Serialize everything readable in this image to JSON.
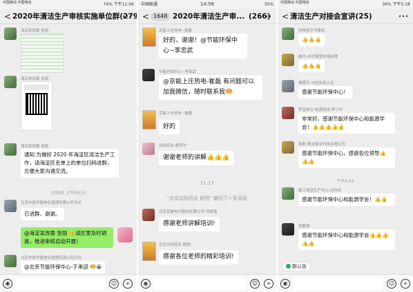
{
  "colors": {
    "bubble_self": "#95ec69",
    "bubble_other": "#ffffff",
    "chat_bg": "#ededed",
    "accent_green": "#2aae67"
  },
  "phone1": {
    "status": {
      "carrier": "中国移动 中国电信",
      "right": "74% 下午11:06"
    },
    "title": "2020年清洁生产审核实施单位群(279)",
    "back_icon": "<",
    "more_icon": "···",
    "messages": [
      {
        "sender": "海淀发改委 张丽"
      },
      {
        "sender": "海淀发改委 张丽"
      },
      {
        "sender": "海淀发改委 张丽",
        "text": "通知:为做好 2020 年海淀区清洁生产工作，请海淀区名单上的单位扫码进群，方便大家沟通交流。"
      },
      {
        "time": "5月8日 上午09:53"
      },
      {
        "sender": "北京中原华宸物业管理有限公司冯光",
        "text": "已进群、谢谢。"
      },
      {
        "text": "@海淀发改委 张丽 👍请区里及时调度，推进审核启动开展！"
      },
      {
        "sender": "北京中原华宸物业管理有限公司冯光",
        "text": "@北京节能环保中心-于承迎 🥯😀"
      }
    ]
  },
  "phone2": {
    "status": {
      "carrier": "中国联通",
      "time": "14:56",
      "right": "35%"
    },
    "badge": "1648",
    "title": "2020年清洁生产审...",
    "count": "(266)",
    "more_icon": "···",
    "messages": [
      {
        "sender": "京能上庄热电--崔磊",
        "text": "好的，谢谢！@节能环保中心~李忠武"
      },
      {
        "sender": "节能环保中心~李忠武",
        "text": "@京能上庄热电-崔磊 有问题可以加我微信，随时联系我🥯"
      },
      {
        "sender": "京能上庄热电--崔磊",
        "text": "好的"
      },
      {
        "sender": "北陆药业-杨阿宁",
        "text": "谢谢老师的讲解👍👍👍"
      },
      {
        "time": "11:17"
      },
      {
        "system": "\"北京北陆药业 胜阳\" 撤回了一条消息"
      },
      {
        "sender": "北京京能电力股份有限公司-何奇善",
        "text": "感谢老师讲解培训!"
      },
      {
        "sender": "北京北陆药业 胜阳",
        "text": "感谢各位老师的精彩培训!"
      }
    ]
  },
  "phone3": {
    "status": {
      "carrier": "中国移动 中国电信",
      "right": "36% 下午5:18"
    },
    "title": "清洁生产对接会宣讲(25)",
    "more_icon": "···",
    "messages": [
      {
        "sender": "科林蓝宇冯善松",
        "text": "👍👍👍"
      },
      {
        "sender": "杨丹-中环隆悲市场经理",
        "text": "👍👍👍"
      },
      {
        "sender": "谢倚平-中检信息认证",
        "text": "感谢节能环保中心！"
      },
      {
        "sender": "罗金单位-核源测试-李小平",
        "text": "非常好，感谢节能环保中心和能源学会！👍👍👍👍👍"
      },
      {
        "sender": "张新-联合智业科技有限公司",
        "text": "感谢节能环保中心，感谢各位领导👍👍👍"
      },
      {
        "time": "下午4:43"
      },
      {
        "sender": "疑工清洁生产中心-吕作民",
        "text": "感谢节能环保中心和能源学会！👍👍"
      },
      {
        "sender": "常鲍源",
        "text": "感谢节能环保中心和能源学会👍👍👍👍👍"
      }
    ],
    "group_notice": "群公告"
  }
}
